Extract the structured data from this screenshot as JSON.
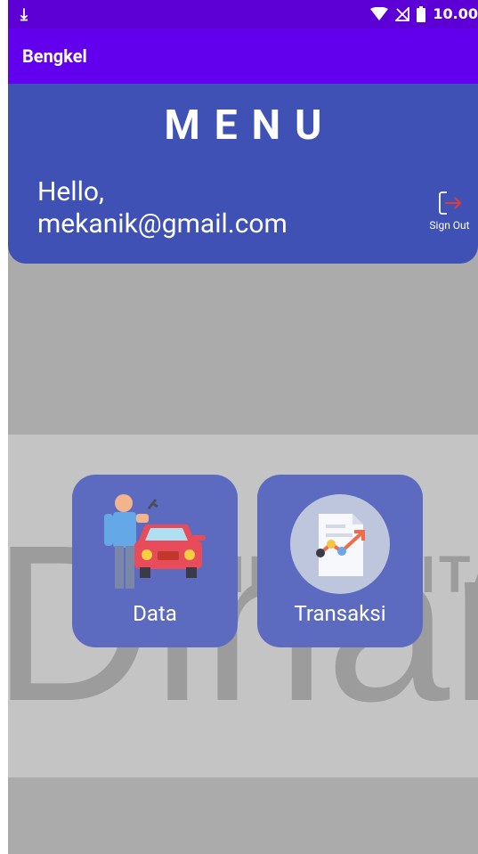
{
  "status_bar": {
    "time": "10.00",
    "icons": [
      "download-icon",
      "wifi-icon",
      "no-signal-icon",
      "battery-icon"
    ]
  },
  "app_bar": {
    "title": "Bengkel"
  },
  "header": {
    "menu_title": "MENU",
    "greeting_line1": "Hello,",
    "greeting_line2": "mekanik@gmail.com",
    "signout_label": "Sign Out"
  },
  "tiles": [
    {
      "label": "Data",
      "icon": "mechanic-car-icon"
    },
    {
      "label": "Transaksi",
      "icon": "report-chart-icon"
    }
  ],
  "watermark": {
    "text_large": "Dinan",
    "text_small": "UNIVERSITA"
  },
  "colors": {
    "status_bar": "#5c00d6",
    "app_bar": "#6200ee",
    "header_card": "#3f51b5",
    "tile": "#5c6bc0",
    "background": "#ababab",
    "signout_arrow": "#e53935"
  }
}
